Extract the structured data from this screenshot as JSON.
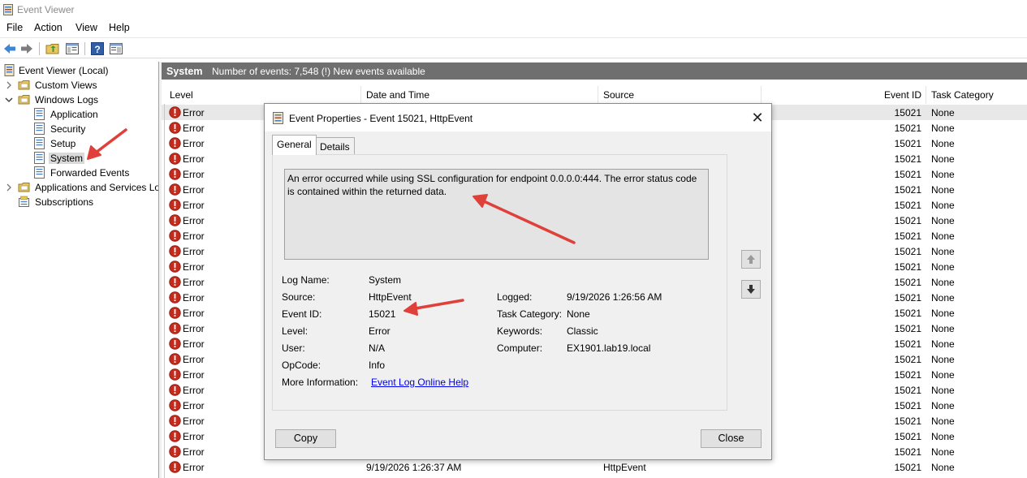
{
  "window": {
    "title": "Event Viewer"
  },
  "menu": [
    "File",
    "Action",
    "View",
    "Help"
  ],
  "toolbar": {
    "icons": [
      "back-arrow-icon",
      "forward-arrow-icon",
      "folder-up-icon",
      "properties-pane-icon",
      "help-icon",
      "action-pane-icon"
    ]
  },
  "tree": {
    "root": "Event Viewer (Local)",
    "custom_views": "Custom Views",
    "windows_logs": "Windows Logs",
    "application": "Application",
    "security": "Security",
    "setup": "Setup",
    "system": "System",
    "forwarded": "Forwarded Events",
    "apps_services": "Applications and Services Lo",
    "subscriptions": "Subscriptions"
  },
  "pane": {
    "name": "System",
    "info": "Number of events: 7,548 (!) New events available"
  },
  "columns": {
    "level": "Level",
    "date": "Date and Time",
    "source": "Source",
    "event_id": "Event ID",
    "task": "Task Category"
  },
  "rows": [
    {
      "level": "Error",
      "date": "",
      "source": "",
      "id": "15021",
      "task": "None"
    },
    {
      "level": "Error",
      "date": "",
      "source": "",
      "id": "15021",
      "task": "None"
    },
    {
      "level": "Error",
      "date": "",
      "source": "",
      "id": "15021",
      "task": "None"
    },
    {
      "level": "Error",
      "date": "",
      "source": "",
      "id": "15021",
      "task": "None"
    },
    {
      "level": "Error",
      "date": "",
      "source": "",
      "id": "15021",
      "task": "None"
    },
    {
      "level": "Error",
      "date": "",
      "source": "",
      "id": "15021",
      "task": "None"
    },
    {
      "level": "Error",
      "date": "",
      "source": "",
      "id": "15021",
      "task": "None"
    },
    {
      "level": "Error",
      "date": "",
      "source": "",
      "id": "15021",
      "task": "None"
    },
    {
      "level": "Error",
      "date": "",
      "source": "",
      "id": "15021",
      "task": "None"
    },
    {
      "level": "Error",
      "date": "",
      "source": "",
      "id": "15021",
      "task": "None"
    },
    {
      "level": "Error",
      "date": "",
      "source": "",
      "id": "15021",
      "task": "None"
    },
    {
      "level": "Error",
      "date": "",
      "source": "",
      "id": "15021",
      "task": "None"
    },
    {
      "level": "Error",
      "date": "",
      "source": "",
      "id": "15021",
      "task": "None"
    },
    {
      "level": "Error",
      "date": "",
      "source": "",
      "id": "15021",
      "task": "None"
    },
    {
      "level": "Error",
      "date": "",
      "source": "",
      "id": "15021",
      "task": "None"
    },
    {
      "level": "Error",
      "date": "",
      "source": "",
      "id": "15021",
      "task": "None"
    },
    {
      "level": "Error",
      "date": "",
      "source": "",
      "id": "15021",
      "task": "None"
    },
    {
      "level": "Error",
      "date": "",
      "source": "",
      "id": "15021",
      "task": "None"
    },
    {
      "level": "Error",
      "date": "",
      "source": "",
      "id": "15021",
      "task": "None"
    },
    {
      "level": "Error",
      "date": "",
      "source": "",
      "id": "15021",
      "task": "None"
    },
    {
      "level": "Error",
      "date": "",
      "source": "",
      "id": "15021",
      "task": "None"
    },
    {
      "level": "Error",
      "date": "",
      "source": "",
      "id": "15021",
      "task": "None"
    },
    {
      "level": "Error",
      "date": "",
      "source": "",
      "id": "15021",
      "task": "None"
    },
    {
      "level": "Error",
      "date": "9/19/2026 1:26:37 AM",
      "source": "HttpEvent",
      "id": "15021",
      "task": "None"
    }
  ],
  "dialog": {
    "title": "Event Properties - Event 15021, HttpEvent",
    "close_glyph": "✕",
    "tabs": [
      "General",
      "Details"
    ],
    "description": "An error occurred while using SSL configuration for endpoint 0.0.0.0:444.  The error status code is contained within the returned data.",
    "labels": {
      "log_name": "Log Name:",
      "source": "Source:",
      "event_id": "Event ID:",
      "level": "Level:",
      "user": "User:",
      "opcode": "OpCode:",
      "more_info": "More Information:",
      "logged": "Logged:",
      "task_category": "Task Category:",
      "keywords": "Keywords:",
      "computer": "Computer:"
    },
    "values": {
      "log_name": "System",
      "source": "HttpEvent",
      "event_id": "15021",
      "level": "Error",
      "user": "N/A",
      "opcode": "Info",
      "more_info_link": "Event Log Online Help",
      "logged": "9/19/2026 1:26:56 AM",
      "task_category": "None",
      "keywords": "Classic",
      "computer": "EX1901.lab19.local"
    },
    "buttons": {
      "copy": "Copy",
      "close": "Close"
    }
  },
  "colors": {
    "annotation_arrow": "#e0403a",
    "pane_header": "#6f6f6f",
    "error_icon": "#c42b1c",
    "link": "#0000ee"
  }
}
